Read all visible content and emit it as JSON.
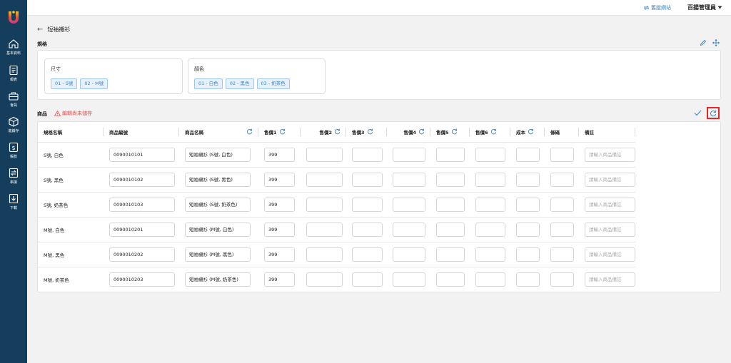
{
  "topbar": {
    "old_site_label": "舊版網站",
    "user_label": "百揚管理員"
  },
  "sidebar": {
    "items": [
      {
        "label": "基本資料",
        "icon": "home-icon"
      },
      {
        "label": "報表",
        "icon": "report-icon"
      },
      {
        "label": "會員",
        "icon": "member-icon"
      },
      {
        "label": "進銷存",
        "icon": "inventory-icon"
      },
      {
        "label": "帳款",
        "icon": "dollar-icon"
      },
      {
        "label": "串接",
        "icon": "link-icon"
      },
      {
        "label": "下載",
        "icon": "download-icon"
      }
    ]
  },
  "header": {
    "title": "短袖襯衫"
  },
  "spec": {
    "title": "規格",
    "groups": [
      {
        "title": "尺寸",
        "options": [
          "01 - S號",
          "02 - M號"
        ]
      },
      {
        "title": "顏色",
        "options": [
          "01 - 白色",
          "02 - 黑色",
          "03 - 奶茶色"
        ]
      }
    ]
  },
  "products": {
    "title": "商品",
    "unsaved_notice": "編輯尚未儲存",
    "columns": [
      "規格名稱",
      "商品編號",
      "商品名稱",
      "售價1",
      "售價2",
      "售價3",
      "售價4",
      "售價5",
      "售價6",
      "成本",
      "條碼",
      "備註"
    ],
    "note_placeholder": "請輸入商品備註",
    "rows": [
      {
        "spec": "S號, 白色",
        "code": "0090010101",
        "name": "短袖襯衫 (S號, 白色)",
        "price1": "399"
      },
      {
        "spec": "S號, 黑色",
        "code": "0090010102",
        "name": "短袖襯衫 (S號, 黑色)",
        "price1": "399"
      },
      {
        "spec": "S號, 奶茶色",
        "code": "0090010103",
        "name": "短袖襯衫 (S號, 奶茶色)",
        "price1": "399"
      },
      {
        "spec": "M號, 白色",
        "code": "0090010201",
        "name": "短袖襯衫 (M號, 白色)",
        "price1": "399"
      },
      {
        "spec": "M號, 黑色",
        "code": "0090010202",
        "name": "短袖襯衫 (M號, 黑色)",
        "price1": "399"
      },
      {
        "spec": "M號, 奶茶色",
        "code": "0090010203",
        "name": "短袖襯衫 (M號, 奶茶色)",
        "price1": "399"
      }
    ]
  },
  "colors": {
    "sidebar_bg": "#153e5c",
    "accent": "#3a86c8",
    "warning": "#e0504f",
    "highlight": "#e32626"
  }
}
